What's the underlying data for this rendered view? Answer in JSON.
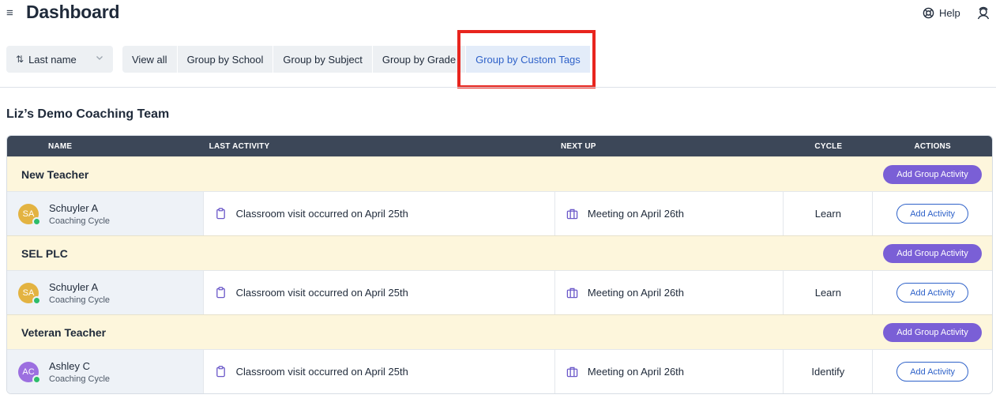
{
  "header": {
    "title": "Dashboard",
    "help_label": "Help",
    "hamburger_glyph": "≡",
    "icons": {
      "menu": "hamburger-icon",
      "help": "lifebuoy-icon",
      "user": "user-icon"
    }
  },
  "toolbar": {
    "sort": {
      "icon_glyph": "⇅",
      "label": "Last name",
      "chevron": "chevron-down-icon"
    },
    "views": [
      {
        "label": "View all",
        "active": false
      },
      {
        "label": "Group by School",
        "active": false
      },
      {
        "label": "Group by Subject",
        "active": false
      },
      {
        "label": "Group by Grade",
        "active": false
      },
      {
        "label": "Group by Custom Tags",
        "active": true
      }
    ],
    "highlight_color": "#e8251e"
  },
  "team": {
    "title": "Liz’s Demo Coaching Team",
    "columns": {
      "name": "NAME",
      "last": "LAST ACTIVITY",
      "next": "NEXT UP",
      "cycle": "CYCLE",
      "actions": "ACTIONS"
    },
    "group_button_label": "Add Group Activity",
    "row_button_label": "Add Activity",
    "groups": [
      {
        "name": "New Teacher",
        "rows": [
          {
            "initials": "SA",
            "avatar_color": "#e3b341",
            "name": "Schuyler A",
            "subtitle": "Coaching Cycle",
            "last_activity": "Classroom visit occurred on April 25th",
            "next_up": "Meeting on April 26th",
            "cycle": "Learn"
          }
        ]
      },
      {
        "name": "SEL PLC",
        "rows": [
          {
            "initials": "SA",
            "avatar_color": "#e3b341",
            "name": "Schuyler A",
            "subtitle": "Coaching Cycle",
            "last_activity": "Classroom visit occurred on April 25th",
            "next_up": "Meeting on April 26th",
            "cycle": "Learn"
          }
        ]
      },
      {
        "name": "Veteran Teacher",
        "rows": [
          {
            "initials": "AC",
            "avatar_color": "#9c6fe0",
            "name": "Ashley C",
            "subtitle": "Coaching Cycle",
            "last_activity": "Classroom visit occurred on April 25th",
            "next_up": "Meeting on April 26th",
            "cycle": "Identify"
          }
        ]
      }
    ]
  },
  "colors": {
    "header_dark": "#3c4758",
    "group_bg": "#fdf6dc",
    "purple_button": "#7a5fd6",
    "link_blue": "#2f62c9",
    "status_online": "#2ebd6b"
  }
}
